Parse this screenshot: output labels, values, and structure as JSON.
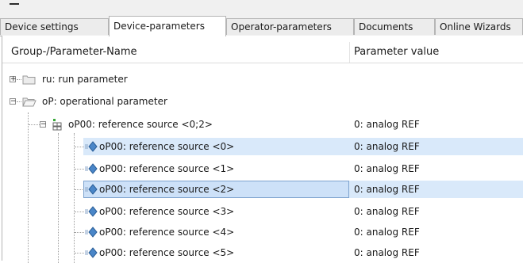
{
  "tabs": [
    {
      "label": "Device settings",
      "active": false
    },
    {
      "label": "Device-parameters",
      "active": true
    },
    {
      "label": "Operator-parameters",
      "active": false
    },
    {
      "label": "Documents",
      "active": false
    },
    {
      "label": "Online Wizards",
      "active": false
    }
  ],
  "columns": {
    "name": "Group-/Parameter-Name",
    "value": "Parameter value"
  },
  "tree": {
    "groups": [
      {
        "label": "ru: run parameter",
        "expanded": false
      },
      {
        "label": "oP: operational parameter",
        "expanded": true
      }
    ],
    "parameter": {
      "label": "oP00: reference source <0;2>",
      "value": "0: analog REF"
    },
    "items": [
      {
        "label": "oP00: reference source <0>",
        "value": "0: analog REF",
        "selected": true
      },
      {
        "label": "oP00: reference source <1>",
        "value": "0: analog REF",
        "selected": false
      },
      {
        "label": "oP00: reference source <2>",
        "value": "0: analog REF",
        "selected": true,
        "focused": true
      },
      {
        "label": "oP00: reference source <3>",
        "value": "0: analog REF",
        "selected": false
      },
      {
        "label": "oP00: reference source <4>",
        "value": "0: analog REF",
        "selected": false
      },
      {
        "label": "oP00: reference source <5>",
        "value": "0: analog REF",
        "selected": false
      }
    ]
  },
  "colors": {
    "selection": "#d9e9fa",
    "focus_border": "#7da2ce",
    "folder": "#e8c55a",
    "param_icon": "#4a86c8"
  }
}
